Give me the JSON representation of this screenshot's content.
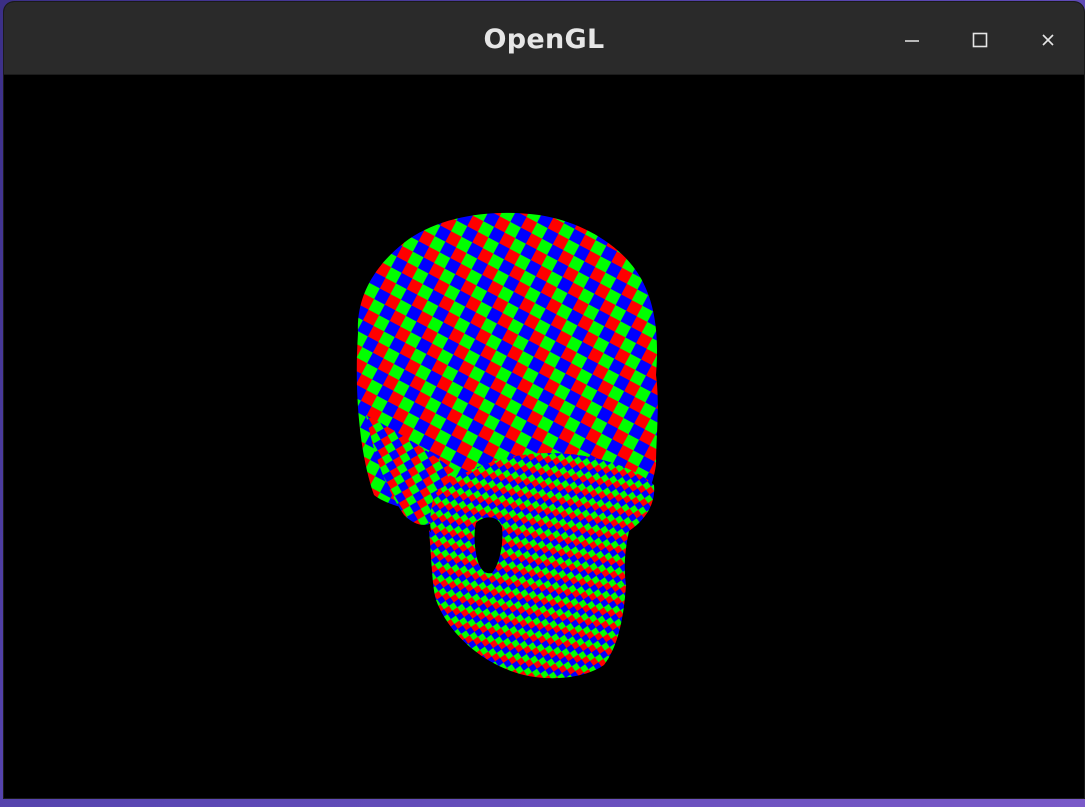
{
  "window": {
    "title": "OpenGL"
  },
  "controls": {
    "minimize_icon": "minimize-icon",
    "maximize_icon": "maximize-icon",
    "close_icon": "close-icon"
  },
  "scene": {
    "background": "#000000",
    "checker_colors": [
      "#ff0000",
      "#00ff00",
      "#0000ff"
    ],
    "object": "textured-skull-mesh"
  },
  "colors": {
    "titlebar": "#2a2a2a",
    "title_text": "#e6e6e6",
    "desktop_accent": "#5a47b3"
  }
}
